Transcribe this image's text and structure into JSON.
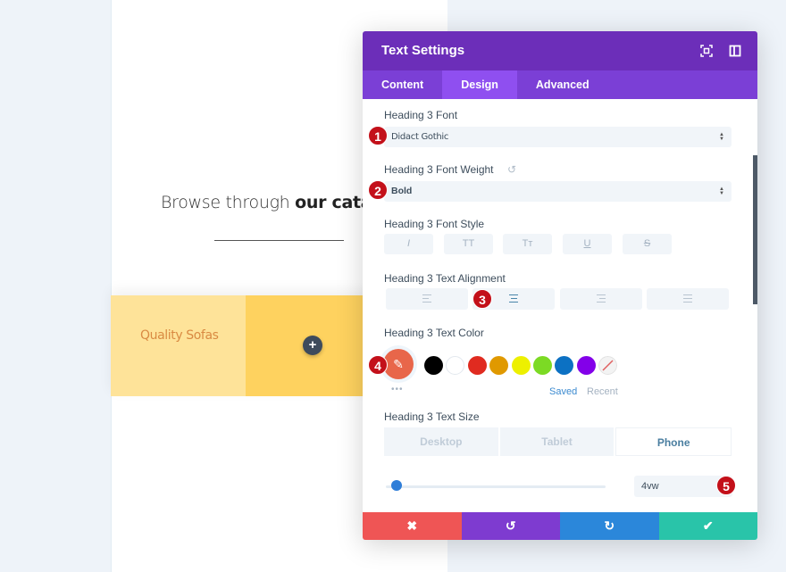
{
  "page": {
    "headline_light": "Browse through ",
    "headline_bold": "our catalo",
    "promo_label": "Quality Sofas",
    "add_icon": "plus-icon"
  },
  "modal": {
    "title": "Text Settings",
    "header_icons": [
      "fullscreen-icon",
      "split-view-icon"
    ],
    "tabs": [
      {
        "label": "Content",
        "active": false
      },
      {
        "label": "Design",
        "active": true
      },
      {
        "label": "Advanced",
        "active": false
      }
    ],
    "font": {
      "label": "Heading 3 Font",
      "value": "Didact Gothic"
    },
    "weight": {
      "label": "Heading 3 Font Weight",
      "value": "Bold"
    },
    "style": {
      "label": "Heading 3 Font Style",
      "buttons": [
        {
          "glyph": "I",
          "name": "italic"
        },
        {
          "glyph": "TT",
          "name": "uppercase"
        },
        {
          "glyph": "Tт",
          "name": "capitalize"
        },
        {
          "glyph": "U",
          "name": "underline"
        },
        {
          "glyph": "S",
          "name": "strikethrough"
        }
      ]
    },
    "alignment": {
      "label": "Heading 3 Text Alignment",
      "options": [
        "left",
        "center",
        "right",
        "justify"
      ],
      "selected": "center"
    },
    "color": {
      "label": "Heading 3 Text Color",
      "current": "#e8664a",
      "swatches": [
        "#000000",
        "#ffffff",
        "#e02b20",
        "#e09900",
        "#edf000",
        "#7cda24",
        "#0c71c3",
        "#8300e9",
        "none"
      ],
      "saved_label": "Saved",
      "recent_label": "Recent",
      "more_label": "•••"
    },
    "size": {
      "label": "Heading 3 Text Size",
      "devices": [
        {
          "label": "Desktop",
          "active": false
        },
        {
          "label": "Tablet",
          "active": false
        },
        {
          "label": "Phone",
          "active": true
        }
      ],
      "slider_fraction": 0.05,
      "value": "4vw"
    },
    "badges": [
      "1",
      "2",
      "3",
      "4",
      "5"
    ],
    "footer": {
      "cancel": "✖",
      "undo": "↺",
      "redo": "↻",
      "save": "✔",
      "colors": {
        "cancel": "#ef5555",
        "undo": "#7e3bd0",
        "redo": "#2b87da",
        "save": "#29c4a9"
      }
    }
  }
}
